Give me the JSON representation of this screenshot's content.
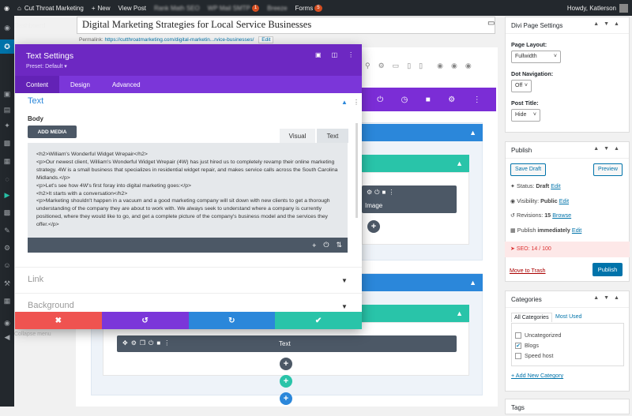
{
  "adminbar": {
    "site": "Cut Throat Marketing",
    "new": "New",
    "view_post": "View Post",
    "rank_math": "Rank Math SEO",
    "wp_mail": "WP Mail SMTP",
    "wp_mail_count": "1",
    "breeze": "Breeze",
    "forms": "Forms",
    "forms_count": "5",
    "howdy": "Howdy, Katlerson"
  },
  "sidebar": {
    "dashboard": "Dashboard",
    "collapse": "Collapse menu"
  },
  "post": {
    "title": "Digital Marketing Strategies for Local Service Businesses",
    "permalink_label": "Permalink:",
    "permalink_url": "https://cutthroatmarketing.com/digital-marketin...rvice-businesses/",
    "edit": "Edit"
  },
  "modal": {
    "title": "Text Settings",
    "preset": "Preset: Default",
    "tabs": [
      "Content",
      "Design",
      "Advanced"
    ],
    "section_text": "Text",
    "body_label": "Body",
    "add_media": "ADD MEDIA",
    "tab_visual": "Visual",
    "tab_text": "Text",
    "body_content": "<h2>William's Wonderful Widget Wrepair</h2>\n<p>Our newest client, William's Wonderful Widget Wrepair (4W) has just hired us to completely revamp their online marketing strategy. 4W is a small business that specializes in residential widget repair, and makes service calls across the South Carolina Midlands.</p>\n<p>Let's see how 4W's first foray into digital marketing goes:</p>\n<h2>It starts with a conversation</h2>\n<p>Marketing shouldn't happen in a vacuum and a good marketing company will sit down with new clients to get a thorough understanding of the company they are about to work with. We always seek to understand where a company is currently positioned, where they would like to go, and get a complete picture of the company's business model and the services they offer.</p>",
    "section_link": "Link",
    "section_background": "Background"
  },
  "builder": {
    "image_module": "Image",
    "text_module": "Text"
  },
  "divi_settings": {
    "title": "Divi Page Settings",
    "layout_label": "Page Layout:",
    "layout_value": "Fullwidth",
    "dotnav_label": "Dot Navigation:",
    "dotnav_value": "Off",
    "posttitle_label": "Post Title:",
    "posttitle_value": "Hide"
  },
  "publish": {
    "title": "Publish",
    "save_draft": "Save Draft",
    "preview": "Preview",
    "status_label": "Status:",
    "status_value": "Draft",
    "visibility_label": "Visibility:",
    "visibility_value": "Public",
    "revisions_label": "Revisions:",
    "revisions_value": "15",
    "browse": "Browse",
    "publish_label": "Publish",
    "publish_when": "immediately",
    "edit": "Edit",
    "seo": "SEO: 14 / 100",
    "trash": "Move to Trash",
    "publish_btn": "Publish"
  },
  "categories": {
    "title": "Categories",
    "tab_all": "All Categories",
    "tab_used": "Most Used",
    "items": [
      {
        "label": "Uncategorized",
        "checked": false
      },
      {
        "label": "Blogs",
        "checked": true
      },
      {
        "label": "Speed host",
        "checked": false
      }
    ],
    "add_new": "+ Add New Category"
  },
  "tags": {
    "title": "Tags"
  },
  "colors": {
    "purple": "#6d28c2",
    "blue": "#2b87da",
    "green": "#29c4a9",
    "red": "#ef5350"
  }
}
